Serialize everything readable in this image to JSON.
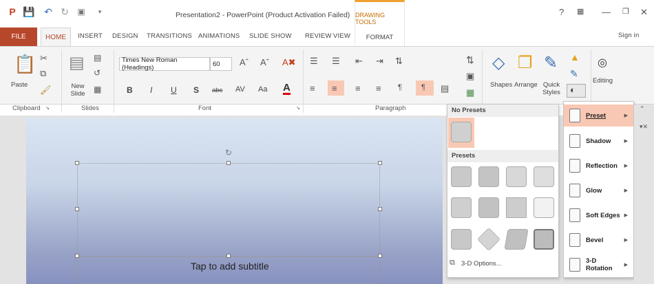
{
  "window": {
    "title": "Presentation2 - PowerPoint (Product Activation Failed)",
    "contextual_group": "DRAWING TOOLS",
    "help": "?",
    "sign_in": "Sign in"
  },
  "tabs": [
    "FILE",
    "HOME",
    "INSERT",
    "DESIGN",
    "TRANSITIONS",
    "ANIMATIONS",
    "SLIDE SHOW",
    "REVIEW",
    "VIEW",
    "FORMAT"
  ],
  "ribbon": {
    "clipboard": {
      "paste": "Paste",
      "group": "Clipboard"
    },
    "slides": {
      "new_slide": "New Slide",
      "group": "Slides"
    },
    "font": {
      "font_name": "Times New Roman (Headings)",
      "font_size": "60",
      "group": "Font",
      "bold": "B",
      "italic": "I",
      "underline": "U",
      "shadow": "S",
      "strike": "abc",
      "spacing": "AV",
      "case": "Aa"
    },
    "paragraph": {
      "group": "Paragraph"
    },
    "drawing": {
      "shapes": "Shapes",
      "arrange": "Arrange",
      "quick_styles": "Quick Styles"
    },
    "editing": {
      "label": "Editing"
    }
  },
  "slide": {
    "subtitle_placeholder": "Tap to add subtitle"
  },
  "presets_panel": {
    "no_presets_header": "No Presets",
    "presets_header": "Presets",
    "options_link": "3-D Options..."
  },
  "effects_menu": {
    "items": [
      "Preset",
      "Shadow",
      "Reflection",
      "Glow",
      "Soft Edges",
      "Bevel",
      "3-D Rotation"
    ],
    "selected": "Preset"
  },
  "colors": {
    "accent": "#b7472a",
    "highlight": "#f9c8b4",
    "drawing_tools": "#f0a030"
  }
}
